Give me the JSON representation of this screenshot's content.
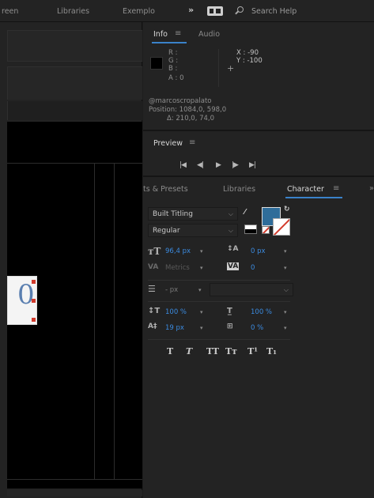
{
  "menu": {
    "items": [
      "reen",
      "Libraries",
      "Exemplo"
    ],
    "overflow": "»",
    "search_placeholder": "Search Help"
  },
  "info": {
    "tabs": [
      "Info",
      "Audio"
    ],
    "menu_glyph": "≡",
    "rgb": [
      "R :",
      "G :",
      "B :",
      "A : 0"
    ],
    "x": "X : -90",
    "y": "Y : -100",
    "layer": "@marcoscropalato",
    "position": "Position: 1084,0, 598,0",
    "delta": "Δ: 210,0, 74,0"
  },
  "preview": {
    "title": "Preview",
    "menu_glyph": "≡",
    "buttons": [
      "|◀",
      "◀|",
      "▶",
      "|▶",
      "▶|"
    ]
  },
  "tabs2": {
    "effects": "ts & Presets",
    "libraries": "Libraries",
    "character": "Character",
    "menu_glyph": "≡",
    "close": "»"
  },
  "character": {
    "font_family": "Built Titling",
    "font_style": "Regular",
    "font_size": "96,4 px",
    "leading_label": "0 px",
    "kerning": "Metrics",
    "tracking": "0",
    "stroke_width": "- px",
    "vert_scale": "100 %",
    "horiz_scale": "100 %",
    "baseline_shift": "19 px",
    "tsume": "0 %",
    "style_buttons": [
      "T",
      "T",
      "TT",
      "Tт",
      "T¹",
      "T₁"
    ],
    "fill_color": "#2f6d9a"
  },
  "colors": {
    "accent": "#3a82c9",
    "value_blue": "#3b8be0"
  }
}
